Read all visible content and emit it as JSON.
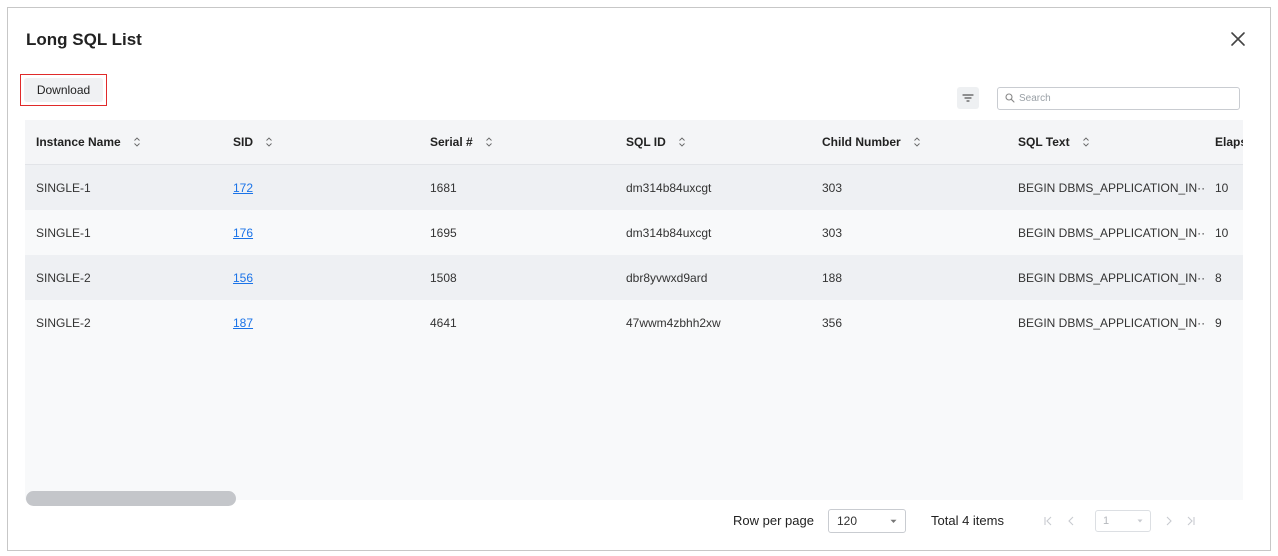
{
  "dialog": {
    "title": "Long SQL List",
    "close_icon": "close-icon"
  },
  "toolbar": {
    "download_label": "Download",
    "filter_icon": "filter-icon",
    "search_placeholder": "Search",
    "search_value": ""
  },
  "table": {
    "columns": [
      "Instance Name",
      "SID",
      "Serial #",
      "SQL ID",
      "Child Number",
      "SQL Text",
      "Elaps"
    ],
    "rows": [
      {
        "instance": "SINGLE-1",
        "sid": "172",
        "serial": "1681",
        "sql_id": "dm314b84uxcgt",
        "child": "303",
        "sql_text": "BEGIN DBMS_APPLICATION_IN···",
        "elapsed": "10"
      },
      {
        "instance": "SINGLE-1",
        "sid": "176",
        "serial": "1695",
        "sql_id": "dm314b84uxcgt",
        "child": "303",
        "sql_text": "BEGIN DBMS_APPLICATION_IN···",
        "elapsed": "10"
      },
      {
        "instance": "SINGLE-2",
        "sid": "156",
        "serial": "1508",
        "sql_id": "dbr8yvwxd9ard",
        "child": "188",
        "sql_text": "BEGIN DBMS_APPLICATION_IN···",
        "elapsed": "8"
      },
      {
        "instance": "SINGLE-2",
        "sid": "187",
        "serial": "4641",
        "sql_id": "47wwm4zbhh2xw",
        "child": "356",
        "sql_text": "BEGIN DBMS_APPLICATION_IN···",
        "elapsed": "9"
      }
    ]
  },
  "pagination": {
    "rows_per_page_label": "Row per page",
    "rows_per_page_value": "120",
    "total_label": "Total 4 items",
    "current_page": "1"
  },
  "colors": {
    "link": "#1a73e8",
    "highlight_border": "#e02a2a"
  }
}
